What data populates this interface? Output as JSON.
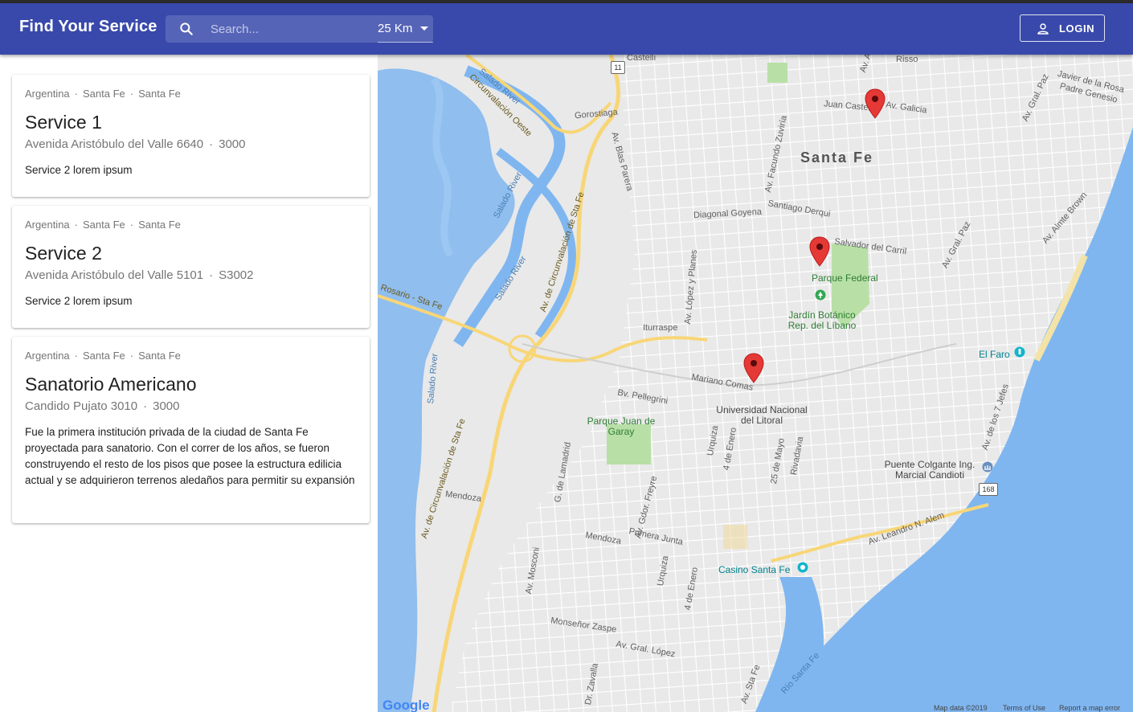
{
  "app": {
    "title": "Find Your Service"
  },
  "search": {
    "placeholder": "Search...",
    "radius": "25 Km"
  },
  "login": {
    "label": "LOGIN"
  },
  "services": [
    {
      "country": "Argentina",
      "province": "Santa Fe",
      "city": "Santa Fe",
      "name": "Service 1",
      "address": "Avenida Aristóbulo del Valle 6640",
      "zip": "3000",
      "description": "Service 2 lorem ipsum"
    },
    {
      "country": "Argentina",
      "province": "Santa Fe",
      "city": "Santa Fe",
      "name": "Service 2",
      "address": "Avenida Aristóbulo del Valle 5101",
      "zip": "S3002",
      "description": "Service 2 lorem ipsum"
    },
    {
      "country": "Argentina",
      "province": "Santa Fe",
      "city": "Santa Fe",
      "name": "Sanatorio Americano",
      "address": "Candido Pujato 3010",
      "zip": "3000",
      "description": "Fue la primera institución privada de la ciudad de Santa Fe proyectada para sanatorio. Con el correr de los años, se fueron construyendo el resto de los pisos que posee la estructura edilicia actual y se adquirieron terrenos aledaños para permitir su expansión"
    }
  ],
  "map": {
    "city": "Santa Fe",
    "streets": {
      "castelli_top": "Castelli",
      "risso": "Risso",
      "javier_rosa": "Javier de la Rosa",
      "padre_genesio": "Padre Genesio",
      "juan_castelli": "Juan Castelli",
      "galicia": "Av. Galicia",
      "aristobulo": "Av. Aristóbulo del Valle",
      "gral_paz_top": "Av. Gral. Paz",
      "gorostiaga": "Gorostiaga",
      "blas_parera": "Av. Blas Parera",
      "facundo_zuviria": "Av. Facundo Zuviría",
      "circ_oeste": "Circunvalación Oeste",
      "diagonal_goyena": "Diagonal Goyena",
      "santiago_derqui": "Santiago Derqui",
      "salvador_carril": "Salvador del Carril",
      "gral_paz_mid": "Av. Gral. Paz",
      "almte_brown": "Av. Almte Brown",
      "av_circ_sta_fe_1": "Av. de Circunvalación de Sta Fe",
      "lopez_planes": "Av. López y Planes",
      "rosario_sta_fe": "Rosario - Sta Fe",
      "iturraspe": "Iturraspe",
      "mariano_comas": "Mariano Comas",
      "pellegrini": "Bv. Pellegrini",
      "siete_jefes": "Av. de los 7 Jefes",
      "urquiza_1": "Urquiza",
      "cuatro_enero_1": "4 de Enero",
      "veinticinco_mayo": "25 de Mayo",
      "rivadavia": "Rivadavia",
      "lamadrid": "G. de Lamadrid",
      "gdor_freyre": "Av. Gdor. Freyre",
      "av_circ_sta_fe_2": "Av. de Circunvalación de Sta Fe",
      "mendoza_1": "Mendoza",
      "mendoza_2": "Mendoza",
      "primera_junta": "Primera Junta",
      "leandro_alem": "Av. Leandro N. Alem",
      "mosconi": "Av. Mosconi",
      "urquiza_2": "Urquiza",
      "cuatro_enero_2": "4 de Enero",
      "monsenor_zaspe": "Monseñor Zaspe",
      "gral_lopez": "Av. Gral. López",
      "zavalla": "Dr. Zavalla",
      "av_sta_fe": "Av. Sta Fe"
    },
    "water": {
      "salado_1": "Salado River",
      "salado_2": "Salado River",
      "salado_3": "Salado River",
      "salado_4": "Salado River",
      "santa_fe_river": "Río Santa Fe"
    },
    "places": {
      "parque_federal": "Parque Federal",
      "jardin": "Jardín Botánico Rep. del Líbano",
      "el_faro": "El Faro",
      "universidad": "Universidad Nacional del Litoral",
      "parque_garay": "Parque Juan de Garay",
      "puente": "Puente Colgante Ing. Marcial Candioti",
      "casino": "Casino Santa Fe"
    },
    "shields": {
      "r11": "11",
      "r168": "168"
    },
    "google": "Google",
    "footer": {
      "map_data": "Map data ©2019",
      "terms": "Terms of Use",
      "report": "Report a map error"
    },
    "colors": {
      "land": "#e9e9e9",
      "water": "#7fb6f0",
      "park": "#b8e0a6",
      "highway": "#f8d677",
      "pin": "#e53935"
    }
  }
}
